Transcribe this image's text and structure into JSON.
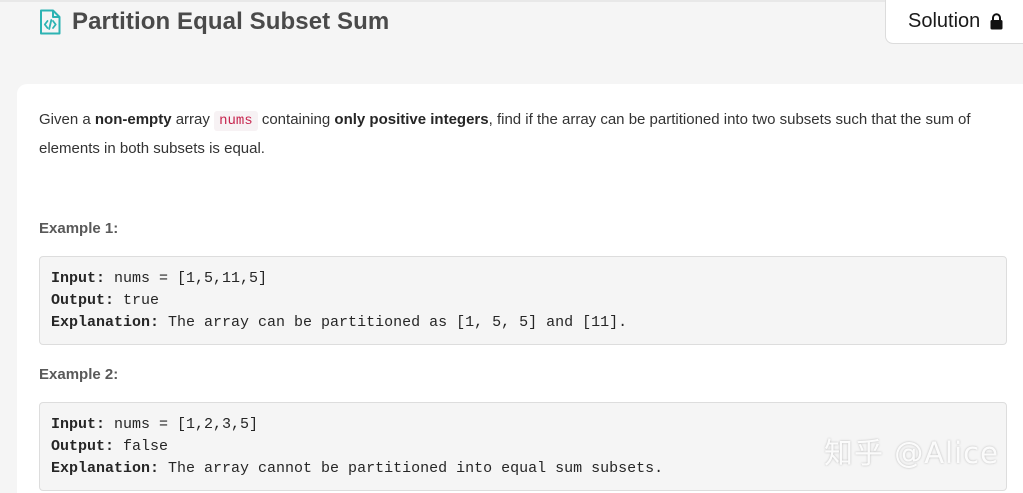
{
  "problem": {
    "title": "Partition Equal Subset Sum",
    "solution_label": "Solution"
  },
  "description": {
    "p1": "Given a ",
    "b1": "non-empty",
    "p2": " array ",
    "code": "nums",
    "p3": " containing ",
    "b2": "only positive integers",
    "p4": ", find if the array can be partitioned into two subsets such that the sum of elements in both subsets is equal."
  },
  "examples": [
    {
      "heading": "Example 1:",
      "input_label": "Input:",
      "input_value": " nums = [1,5,11,5]",
      "output_label": "Output:",
      "output_value": " true",
      "explanation_label": "Explanation:",
      "explanation_value": " The array can be partitioned as [1, 5, 5] and [11]."
    },
    {
      "heading": "Example 2:",
      "input_label": "Input:",
      "input_value": " nums = [1,2,3,5]",
      "output_label": "Output:",
      "output_value": " false",
      "explanation_label": "Explanation:",
      "explanation_value": " The array cannot be partitioned into equal sum subsets."
    }
  ],
  "watermark": "知乎 @Alice",
  "icons": {
    "title_icon": "code-file-icon",
    "lock_icon": "lock-icon"
  },
  "colors": {
    "accent_teal": "#2db3b3",
    "inline_code": "#c7254e"
  }
}
